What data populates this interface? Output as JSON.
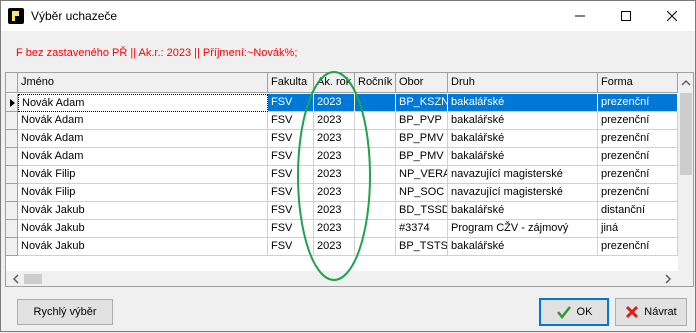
{
  "window": {
    "title": "Výběr uchazeče",
    "filter_text": "F bez zastaveného PŘ || Ak.r.: 2023 || Příjmení:~Novák%;"
  },
  "grid": {
    "columns": [
      "Jméno",
      "Fakulta",
      "Ak. rok",
      "Ročník",
      "Obor",
      "Druh",
      "Forma"
    ],
    "rows": [
      [
        "Novák Adam",
        "FSV",
        "2023",
        "",
        "BP_KSZN",
        "bakalářské",
        "prezenční"
      ],
      [
        "Novák Adam",
        "FSV",
        "2023",
        "",
        "BP_PVP",
        "bakalářské",
        "prezenční"
      ],
      [
        "Novák Adam",
        "FSV",
        "2023",
        "",
        "BP_PMV",
        "bakalářské",
        "prezenční"
      ],
      [
        "Novák Adam",
        "FSV",
        "2023",
        "",
        "BP_PMV",
        "bakalářské",
        "prezenční"
      ],
      [
        "Novák Filip",
        "FSV",
        "2023",
        "",
        "NP_VERAS",
        "navazující magisterské",
        "prezenční"
      ],
      [
        "Novák Filip",
        "FSV",
        "2023",
        "",
        "NP_SOC",
        "navazující magisterské",
        "prezenční"
      ],
      [
        "Novák Jakub",
        "FSV",
        "2023",
        "",
        "BD_TSSD",
        "bakalářské",
        "distanční"
      ],
      [
        "Novák Jakub",
        "FSV",
        "2023",
        "",
        "#3374",
        "Program CŽV - zájmový",
        "jiná"
      ],
      [
        "Novák Jakub",
        "FSV",
        "2023",
        "",
        "BP_TSTS",
        "bakalářské",
        "prezenční"
      ]
    ],
    "selected_row": 0
  },
  "buttons": {
    "quick_select": "Rychlý výběr",
    "ok": "OK",
    "back": "Návrat"
  },
  "colors": {
    "selection": "#0078d7",
    "filter_text": "#ff0000",
    "annotation_ellipse": "#1fa34a"
  },
  "icons": {
    "app": "app-icon",
    "ok": "checkmark-icon",
    "back": "red-x-icon"
  }
}
